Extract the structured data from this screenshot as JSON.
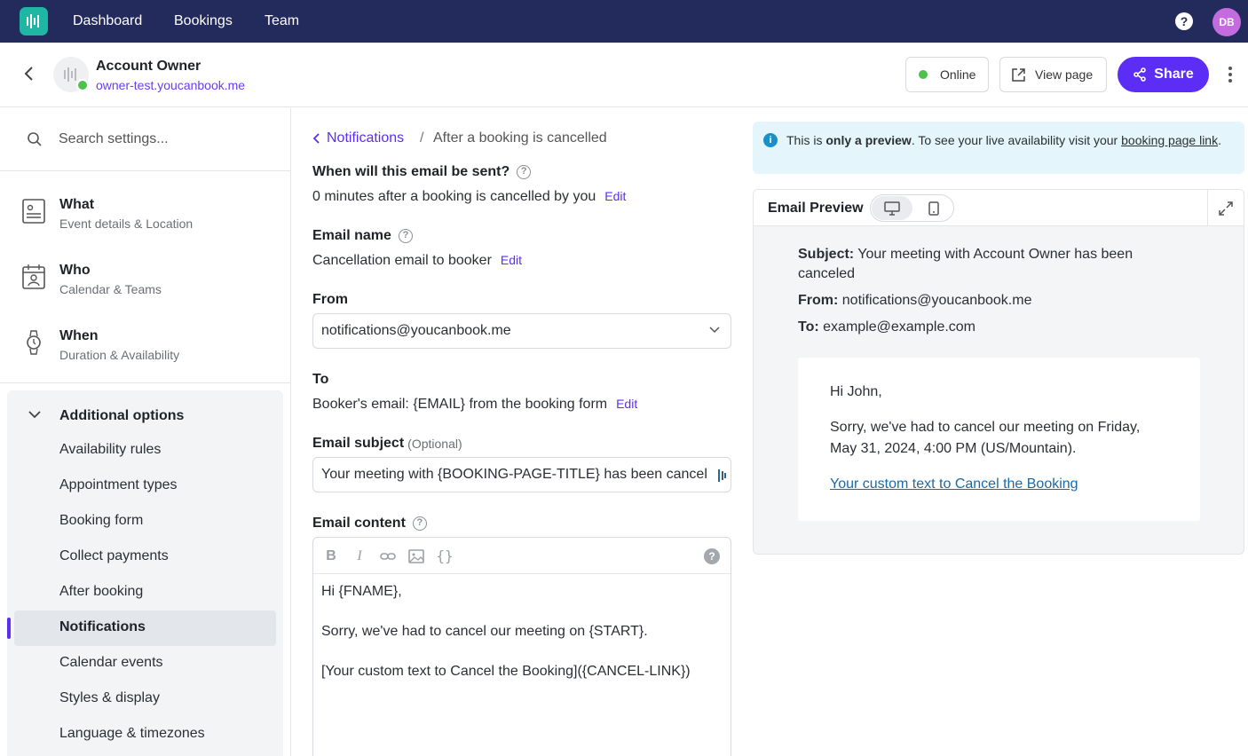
{
  "topnav": {
    "links": [
      "Dashboard",
      "Bookings",
      "Team"
    ],
    "help_label": "?",
    "avatar_initials": "DB"
  },
  "header": {
    "account_name": "Account Owner",
    "account_url": "owner-test.youcanbook.me",
    "status_label": "Online",
    "view_page_label": "View page",
    "share_label": "Share"
  },
  "sidebar": {
    "search_placeholder": "Search settings...",
    "sections": [
      {
        "title": "What",
        "subtitle": "Event details & Location",
        "icon": "document-icon"
      },
      {
        "title": "Who",
        "subtitle": "Calendar & Teams",
        "icon": "calendar-person-icon"
      },
      {
        "title": "When",
        "subtitle": "Duration & Availability",
        "icon": "watch-icon"
      }
    ],
    "additional_title": "Additional options",
    "options": [
      "Availability rules",
      "Appointment types",
      "Booking form",
      "Collect payments",
      "After booking",
      "Notifications",
      "Calendar events",
      "Styles & display",
      "Language & timezones"
    ],
    "active_option": "Notifications"
  },
  "breadcrumb": {
    "parent": "Notifications",
    "separator": "/",
    "current": "After a booking is cancelled"
  },
  "form": {
    "when_label": "When will this email be sent?",
    "when_value": "0 minutes after a booking is cancelled by you",
    "name_label": "Email name",
    "name_value": "Cancellation email to booker",
    "from_label": "From",
    "from_value": "notifications@youcanbook.me",
    "to_label": "To",
    "to_value": "Booker's email: {EMAIL} from the booking form",
    "subject_label": "Email subject",
    "subject_optional": "(Optional)",
    "subject_value": "Your meeting with {BOOKING-PAGE-TITLE} has been cancel",
    "content_label": "Email content",
    "edit_label": "Edit",
    "content_lines": [
      "Hi {FNAME},",
      "Sorry, we've had to cancel our meeting on {START}.",
      "[Your custom text to Cancel the Booking]({CANCEL-LINK})"
    ]
  },
  "notice": {
    "prefix": "This is ",
    "bold": "only a preview",
    "middle": ". To see your live availability visit your ",
    "link": "booking page link",
    "suffix": "."
  },
  "preview": {
    "title": "Email Preview",
    "subject_label": "Subject:",
    "subject_value": "Your meeting with Account Owner has been canceled",
    "from_label": "From:",
    "from_value": "notifications@youcanbook.me",
    "to_label": "To:",
    "to_value": "example@example.com",
    "greeting": "Hi John,",
    "body_line1": "Sorry, we've had to cancel our meeting on Friday,",
    "body_line2": "May 31, 2024, 4:00 PM (US/Mountain).",
    "link_text": "Your custom text to Cancel the Booking"
  },
  "colors": {
    "nav_bg": "#232a5c",
    "accent": "#5b2df5",
    "online": "#4cc14e"
  }
}
